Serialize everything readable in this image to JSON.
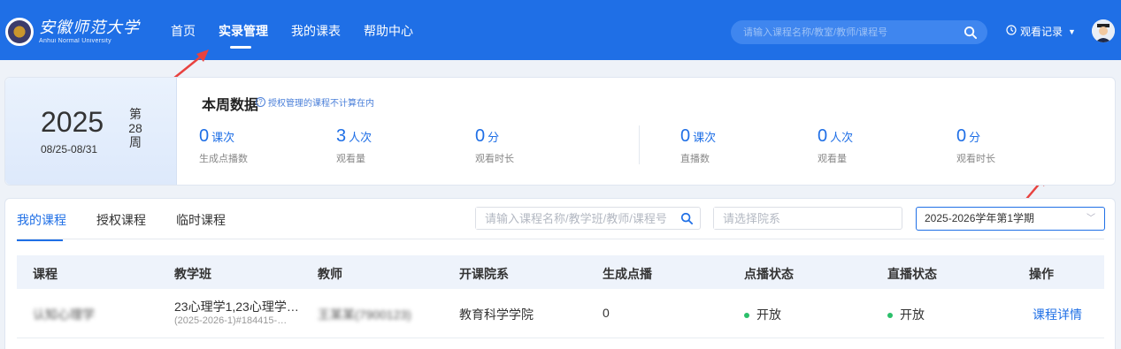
{
  "header": {
    "logo_cn": "安徽师范大学",
    "logo_en": "Anhui Normal University",
    "nav": [
      "首页",
      "实录管理",
      "我的课表",
      "帮助中心"
    ],
    "search_placeholder": "请输入课程名称/教室/教师/课程号",
    "history_label": "观看记录"
  },
  "week": {
    "year": "2025",
    "range": "08/25-08/31",
    "week_prefix": "第",
    "week_no": "28",
    "week_suffix": "周"
  },
  "stats": {
    "title": "本周数据",
    "note": "授权管理的课程不计算在内",
    "metrics": [
      {
        "value": "0",
        "unit": "课次",
        "label": "生成点播数"
      },
      {
        "value": "3",
        "unit": "人次",
        "label": "观看量"
      },
      {
        "value": "0",
        "unit": "分",
        "label": "观看时长"
      },
      {
        "value": "0",
        "unit": "课次",
        "label": "直播数"
      },
      {
        "value": "0",
        "unit": "人次",
        "label": "观看量"
      },
      {
        "value": "0",
        "unit": "分",
        "label": "观看时长"
      }
    ]
  },
  "courses": {
    "tabs": [
      "我的课程",
      "授权课程",
      "临时课程"
    ],
    "search_placeholder": "请输入课程名称/教学班/教师/课程号",
    "dept_placeholder": "请选择院系",
    "term_selected": "2025-2026学年第1学期",
    "columns": [
      "课程",
      "教学班",
      "教师",
      "开课院系",
      "生成点播",
      "点播状态",
      "直播状态",
      "操作"
    ],
    "row": {
      "course": "认知心理学",
      "class_line1": "23心理学1,23心理学…",
      "class_line2": "(2025-2026-1)#184415-…",
      "teacher": "王某某(7900123)",
      "dept": "教育科学学院",
      "vod_count": "0",
      "vod_status": "开放",
      "live_status": "开放",
      "action": "课程详情"
    }
  },
  "colors": {
    "primary": "#1f6fe6",
    "annotation": "#e8423f",
    "status_dot": "#2bbf6a"
  }
}
